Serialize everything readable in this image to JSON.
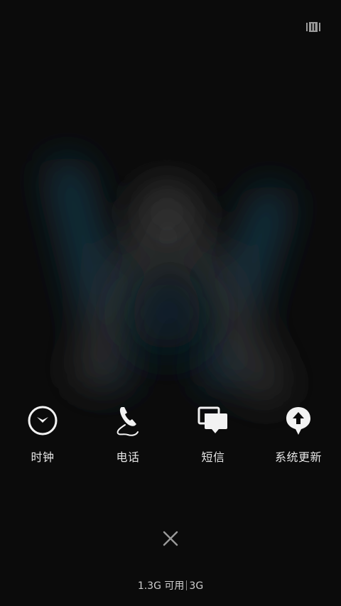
{
  "icons": {
    "corner": "cards-icon",
    "close": "close-icon"
  },
  "apps": [
    {
      "label": "时钟",
      "icon": "clock-icon"
    },
    {
      "label": "电话",
      "icon": "phone-icon"
    },
    {
      "label": "短信",
      "icon": "message-icon"
    },
    {
      "label": "系统更新",
      "icon": "system-update-icon"
    }
  ],
  "memory": {
    "available": "1.3G 可用",
    "network": "3G"
  },
  "colors": {
    "background": "#0b0b0b",
    "text": "#e6e6e6",
    "icon": "#f2f2f2"
  }
}
